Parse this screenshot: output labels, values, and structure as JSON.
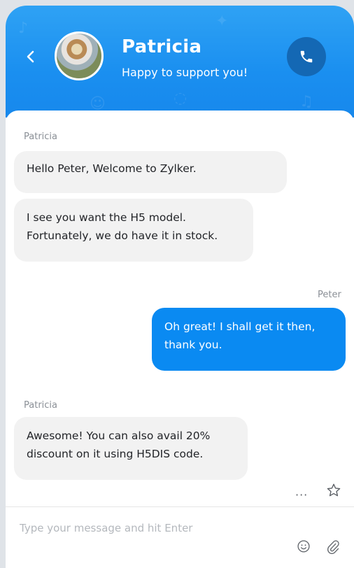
{
  "header": {
    "agent_name": "Patricia",
    "agent_status": "Happy to support you!",
    "back_icon": "chevron-left-icon",
    "call_icon": "phone-icon",
    "accent_color": "#1a8ff0"
  },
  "messages": [
    {
      "sender": "Patricia",
      "direction": "incoming",
      "bubbles": [
        {
          "lines": [
            "Hello Peter, Welcome to Zylker."
          ]
        },
        {
          "lines": [
            "I see you want the H5 model.",
            "Fortunately, we do have it in stock."
          ]
        }
      ]
    },
    {
      "sender": "Peter",
      "direction": "outgoing",
      "bubbles": [
        {
          "lines": [
            "Oh great! I shall get it then,",
            "thank you."
          ]
        }
      ]
    },
    {
      "sender": "Patricia",
      "direction": "incoming",
      "bubbles": [
        {
          "lines": [
            "Awesome! You can also avail 20%",
            "discount on it using H5DIS code."
          ]
        }
      ]
    }
  ],
  "actions": {
    "more_label": "···",
    "star_icon": "star-icon"
  },
  "composer": {
    "placeholder": "Type your message and hit Enter",
    "emoji_icon": "smiley-icon",
    "attach_icon": "paperclip-icon"
  }
}
